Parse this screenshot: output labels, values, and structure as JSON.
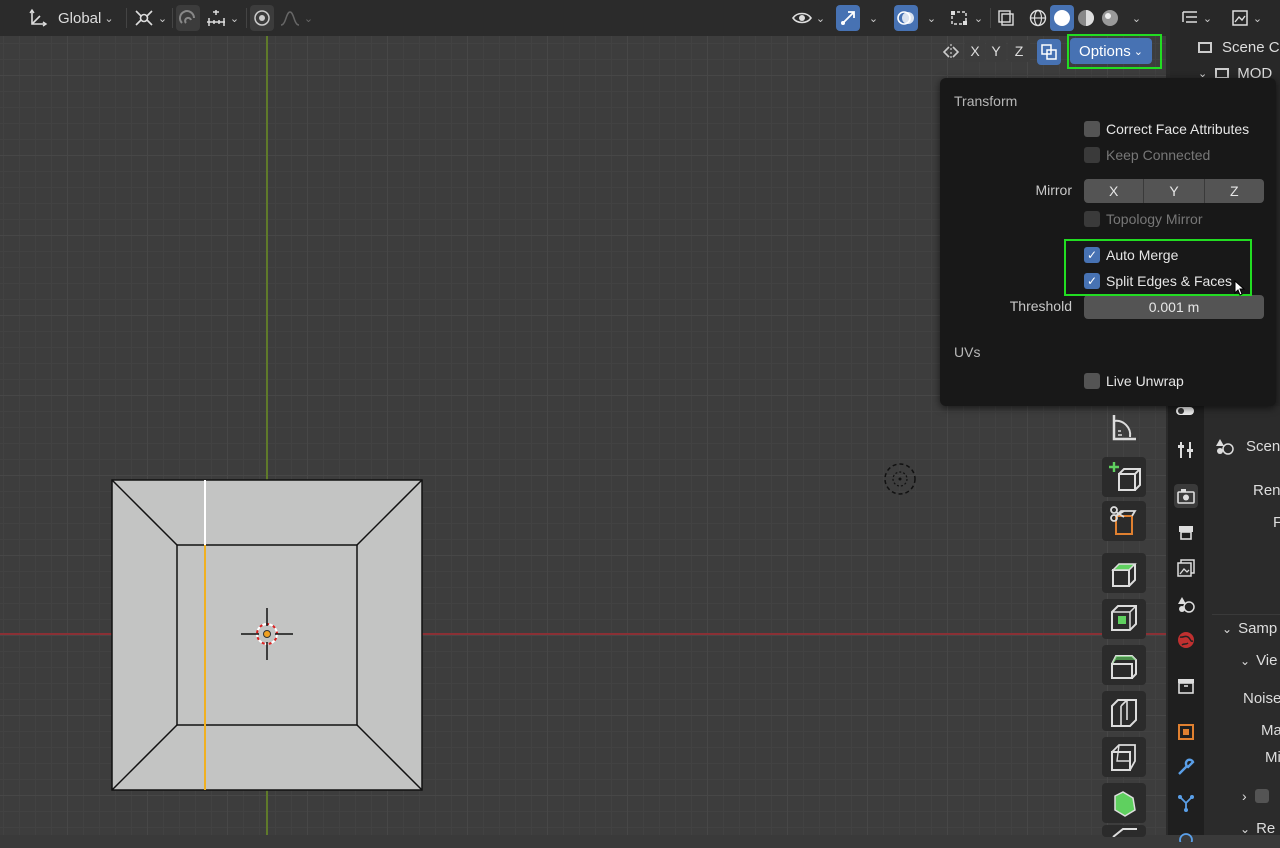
{
  "header": {
    "transform_orientation": "Global",
    "icons": [
      "transform-orientation-icon",
      "pivot-icon",
      "snap-icon",
      "snap-increment-icon",
      "proportional-edit-icon",
      "falloff-icon",
      "visibility-icon",
      "gizmo-icon",
      "overlay-icon",
      "mesh-overlay-icon",
      "xray-icon",
      "shading-wireframe-icon",
      "shading-solid-icon",
      "shading-material-icon",
      "shading-rendered-icon"
    ]
  },
  "mirror_axes": {
    "x": "X",
    "y": "Y",
    "z": "Z"
  },
  "options_button": "Options",
  "popup": {
    "transform_section": "Transform",
    "correct_face_attributes": "Correct Face Attributes",
    "keep_connected": "Keep Connected",
    "mirror_label": "Mirror",
    "mirror_x": "X",
    "mirror_y": "Y",
    "mirror_z": "Z",
    "topology_mirror": "Topology Mirror",
    "auto_merge": "Auto Merge",
    "split_edges_faces": "Split Edges & Faces",
    "threshold_label": "Threshold",
    "threshold_value": "0.001 m",
    "uvs_section": "UVs",
    "live_unwrap": "Live Unwrap",
    "checkmark": "✓"
  },
  "outliner": {
    "scene_collection": "Scene Co",
    "model_item": "MOD"
  },
  "properties": {
    "scene_label": "Scen",
    "render_label": "Ren",
    "f_label": "F",
    "sampling": "Samp",
    "viewport": "Vie",
    "noise": "Noise",
    "max": "Ma",
    "min": "Mi",
    "re": "Re"
  },
  "colors": {
    "accent": "#4772b3",
    "highlight": "#22dd22",
    "x_axis": "#8a3035",
    "y_axis": "#5f7a2a",
    "mesh_face": "#c3c4c3"
  }
}
